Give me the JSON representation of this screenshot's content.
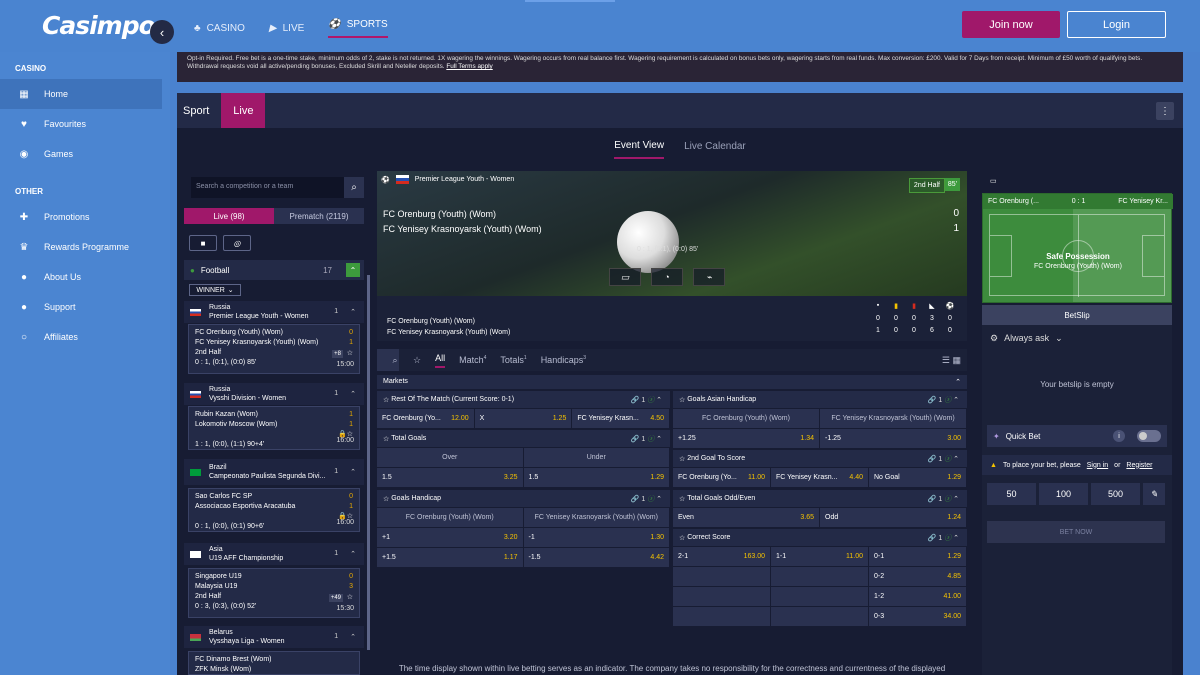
{
  "brand": {
    "logo": "Casimpo"
  },
  "topnav": [
    {
      "label": "CASINO",
      "icon": "♣"
    },
    {
      "label": "LIVE",
      "icon": "▶"
    },
    {
      "label": "SPORTS",
      "icon": "⚽"
    }
  ],
  "header": {
    "join": "Join now",
    "login": "Login"
  },
  "sidebar": {
    "casino_title": "CASINO",
    "casino_items": [
      {
        "label": "Home",
        "icon": "▦"
      },
      {
        "label": "Favourites",
        "icon": "♥"
      },
      {
        "label": "Games",
        "icon": "◉"
      }
    ],
    "other_title": "OTHER",
    "other_items": [
      {
        "label": "Promotions",
        "icon": "✚"
      },
      {
        "label": "Rewards Programme",
        "icon": "♛"
      },
      {
        "label": "About Us",
        "icon": "●"
      },
      {
        "label": "Support",
        "icon": "●"
      },
      {
        "label": "Affiliates",
        "icon": "○"
      }
    ]
  },
  "banner": {
    "text": "Opt-in Required. Free bet is a one-time stake, minimum odds of 2, stake is not returned. 1X wagering the winnings. Wagering occurs from real balance first. Wagering requirement is calculated on bonus bets only, wagering starts from real funds. Max conversion: £200. Valid for 7 Days from receipt. Minimum of £50 worth of qualifying bets. Withdrawal requests void all active/pending bonuses. Excluded Skrill and Neteller deposits.",
    "link": "Full Terms apply"
  },
  "tabs": {
    "sport": "Sport",
    "live": "Live"
  },
  "view_tabs": {
    "event": "Event View",
    "calendar": "Live Calendar"
  },
  "left": {
    "search_placeholder": "Search a competition or a team",
    "live_tab": "Live (98)",
    "prematch_tab": "Prematch (2119)",
    "sport": "Football",
    "sport_count": "17",
    "winner": "WINNER",
    "comps": [
      {
        "country": "Russia",
        "league": "Premier League Youth - Women",
        "count": "1"
      },
      {
        "country": "Russia",
        "league": "Vysshi Division - Women",
        "count": "1"
      },
      {
        "country": "Brazil",
        "league": "Campeonato Paulista Segunda Divi...",
        "count": "1"
      },
      {
        "country": "Asia",
        "league": "U19 AFF Championship",
        "count": "1"
      },
      {
        "country": "Belarus",
        "league": "Vysshaya Liga - Women",
        "count": "1"
      }
    ],
    "matches": [
      {
        "t1": "FC Orenburg (Youth) (Wom)",
        "t2": "FC Yenisey Krasnoyarsk (Youth) (Wom)",
        "s1": "0",
        "s2": "1",
        "status": "2nd Half",
        "info": "0 : 1, (0:1), (0:0) 85'",
        "extra": "+8",
        "time": "15:00"
      },
      {
        "t1": "Rubin Kazan (Wom)",
        "t2": "Lokomotiv Moscow (Wom)",
        "s1": "1",
        "s2": "1",
        "status": "",
        "info": "1 : 1, (0:0), (1:1) 90+4'",
        "extra": "",
        "time": "16:00"
      },
      {
        "t1": "Sao Carlos FC SP",
        "t2": "Associacao Esportiva Aracatuba",
        "s1": "0",
        "s2": "1",
        "status": "",
        "info": "0 : 1, (0:0), (0:1) 90+6'",
        "extra": "",
        "time": "16:00"
      },
      {
        "t1": "Singapore U19",
        "t2": "Malaysia U19",
        "s1": "0",
        "s2": "3",
        "status": "2nd Half",
        "info": "0 : 3, (0:3), (0:0) 52'",
        "extra": "+49",
        "time": "15:30"
      },
      {
        "t1": "FC Dinamo Brest (Wom)",
        "t2": "ZFK Minsk (Wom)",
        "s1": "",
        "s2": "",
        "status": "",
        "info": "",
        "extra": "",
        "time": ""
      }
    ]
  },
  "event": {
    "league": "Premier League Youth - Women",
    "half": "2nd Half",
    "minute": "85'",
    "team1": "FC Orenburg (Youth) (Wom)",
    "team2": "FC Yenisey Krasnoyarsk (Youth) (Wom)",
    "score1": "0",
    "score2": "1",
    "half_scores": "0 : 1, (0:1), (0:0) 85'"
  },
  "stats": {
    "team1": "FC Orenburg (Youth) (Wom)",
    "team2": "FC Yenisey Krasnoyarsk (Youth) (Wom)",
    "row1": [
      "0",
      "0",
      "0",
      "3",
      "0"
    ],
    "row2": [
      "1",
      "0",
      "0",
      "6",
      "0"
    ]
  },
  "market_tabs": [
    {
      "label": "All",
      "sup": ""
    },
    {
      "label": "Match",
      "sup": "4"
    },
    {
      "label": "Totals",
      "sup": "1"
    },
    {
      "label": "Handicaps",
      "sup": "3"
    }
  ],
  "markets_title": "Markets",
  "markets": {
    "rotm": {
      "title": "Rest Of The Match (Current Score: 0-1)",
      "count": "1",
      "cells": [
        {
          "l": "FC Orenburg (Yo...",
          "o": "12.00"
        },
        {
          "l": "X",
          "o": "1.25"
        },
        {
          "l": "FC Yenisey Krasn...",
          "o": "4.50"
        }
      ]
    },
    "totals": {
      "title": "Total Goals",
      "count": "1",
      "over": "Over",
      "under": "Under",
      "cells": [
        {
          "l": "1.5",
          "o": "3.25"
        },
        {
          "l": "1.5",
          "o": "1.29"
        }
      ]
    },
    "gh": {
      "title": "Goals Handicap",
      "count": "1",
      "h1": "FC Orenburg (Youth) (Wom)",
      "h2": "FC Yenisey Krasnoyarsk (Youth) (Wom)",
      "rows": [
        [
          {
            "l": "+1",
            "o": "3.20"
          },
          {
            "l": "-1",
            "o": "1.30"
          }
        ],
        [
          {
            "l": "+1.5",
            "o": "1.17"
          },
          {
            "l": "-1.5",
            "o": "4.42"
          }
        ]
      ]
    },
    "gah": {
      "title": "Goals Asian Handicap",
      "count": "1",
      "h1": "FC Orenburg (Youth) (Wom)",
      "h2": "FC Yenisey Krasnoyarsk (Youth) (Wom)",
      "cells": [
        {
          "l": "+1.25",
          "o": "1.34"
        },
        {
          "l": "-1.25",
          "o": "3.00"
        }
      ]
    },
    "sgts": {
      "title": "2nd Goal To Score",
      "count": "1",
      "cells": [
        {
          "l": "FC Orenburg (Yo...",
          "o": "11.00"
        },
        {
          "l": "FC Yenisey Krasn...",
          "o": "4.40"
        },
        {
          "l": "No Goal",
          "o": "1.29"
        }
      ]
    },
    "oe": {
      "title": "Total Goals Odd/Even",
      "count": "1",
      "cells": [
        {
          "l": "Even",
          "o": "3.65"
        },
        {
          "l": "Odd",
          "o": "1.24"
        }
      ]
    },
    "cs": {
      "title": "Correct Score",
      "count": "1",
      "cells": [
        {
          "l": "2-1",
          "o": "163.00"
        },
        {
          "l": "1-1",
          "o": "11.00"
        },
        {
          "l": "0-1",
          "o": "1.29"
        },
        {
          "l": "0-2",
          "o": "4.85"
        },
        {
          "l": "1-2",
          "o": "41.00"
        },
        {
          "l": "0-3",
          "o": "34.00"
        }
      ]
    }
  },
  "pitch": {
    "t1": "FC Orenburg (...",
    "score": "0 : 1",
    "t2": "FC Yenisey Kr...",
    "status": "Safe Possession",
    "team": "FC Orenburg (Youth) (Wom)"
  },
  "betslip": {
    "tab": "BetSlip",
    "ask": "Always ask",
    "empty": "Your betslip is empty",
    "quick": "Quick Bet",
    "warn_prefix": "To place your bet, please",
    "sign_in": "Sign in",
    "or": "or",
    "register": "Register",
    "stakes": [
      "50",
      "100",
      "500"
    ],
    "bet_now": "BET NOW"
  },
  "disclaimer": "The time display shown within live betting serves as an indicator. The company takes no responsibility for the correctness and currentness of the displayed"
}
